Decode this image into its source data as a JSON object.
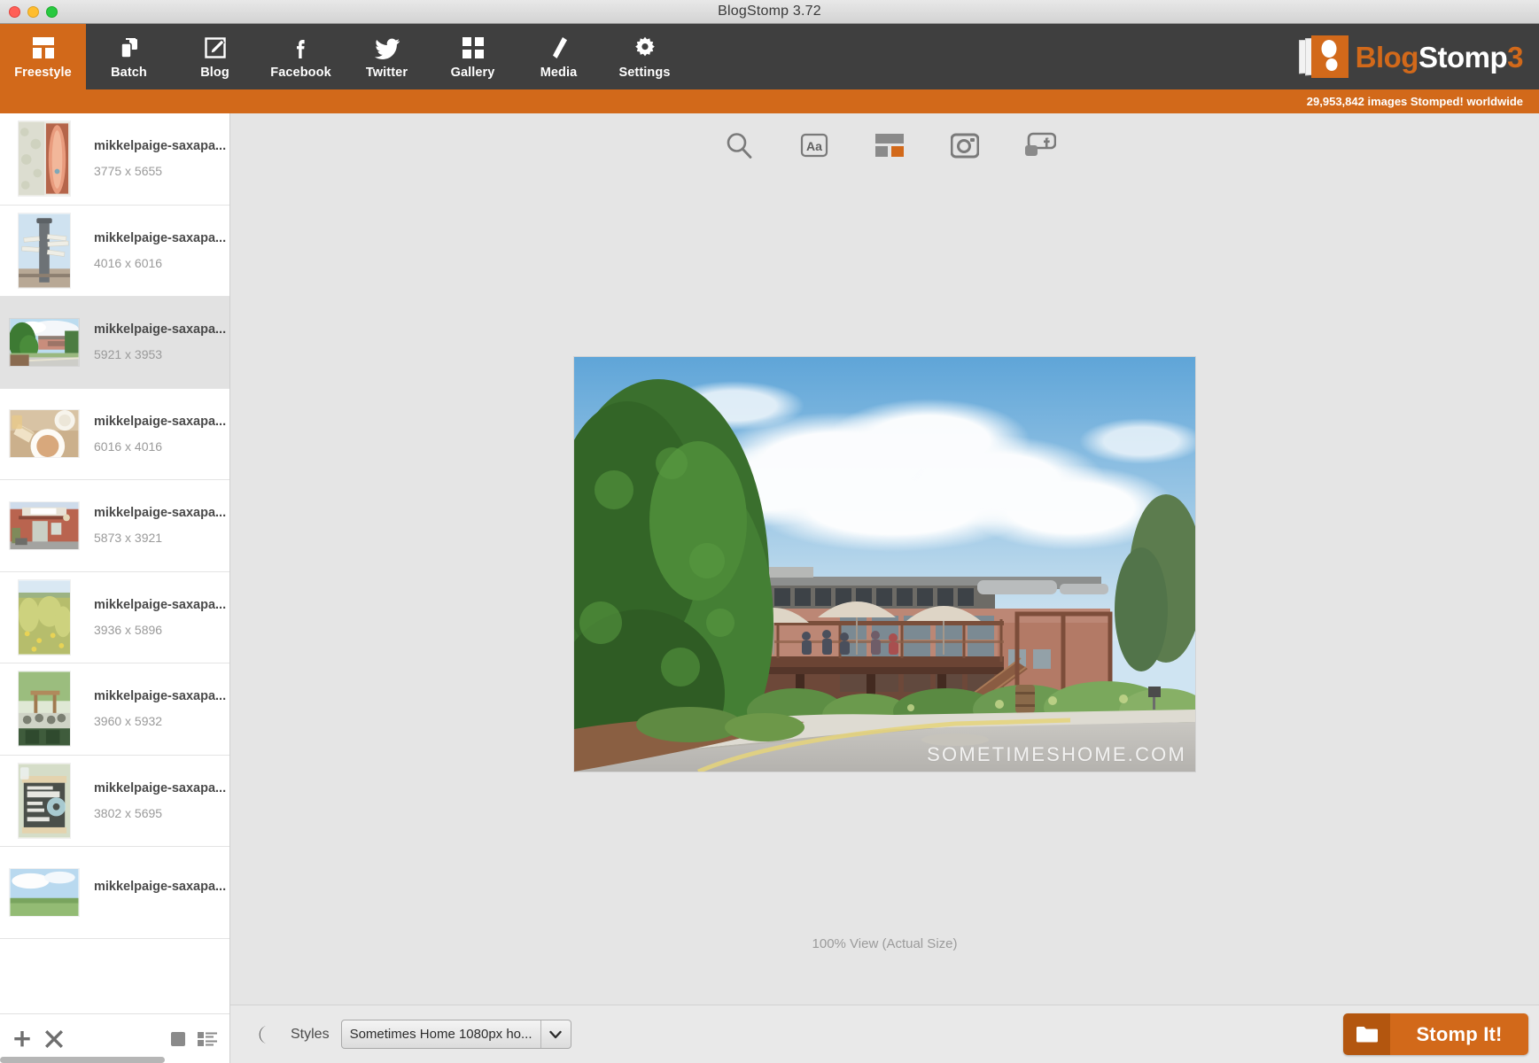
{
  "window": {
    "title": "BlogStomp 3.72",
    "traffic_lights": [
      "close",
      "minimize",
      "maximize"
    ]
  },
  "nav": {
    "items": [
      {
        "label": "Freestyle",
        "icon": "freestyle-layout-icon",
        "active": true
      },
      {
        "label": "Batch",
        "icon": "batch-copy-icon",
        "active": false
      },
      {
        "label": "Blog",
        "icon": "blog-pencil-square-icon",
        "active": false
      },
      {
        "label": "Facebook",
        "icon": "facebook-f-icon",
        "active": false
      },
      {
        "label": "Twitter",
        "icon": "twitter-bird-icon",
        "active": false
      },
      {
        "label": "Gallery",
        "icon": "gallery-grid-icon",
        "active": false
      },
      {
        "label": "Media",
        "icon": "media-pen-icon",
        "active": false
      },
      {
        "label": "Settings",
        "icon": "settings-gear-icon",
        "active": false
      }
    ],
    "brand": {
      "part1": "Blog",
      "part2": "Stomp",
      "part3": "3",
      "icon": "footprint-logo-icon"
    }
  },
  "counter": {
    "text": "29,953,842 images Stomped! worldwide"
  },
  "sidebar": {
    "items": [
      {
        "name": "mikkelpaige-saxapa...",
        "dimensions": "3775 x 5655",
        "orientation": "portrait",
        "selected": false,
        "thumb": "kayak-on-brick-wall"
      },
      {
        "name": "mikkelpaige-saxapa...",
        "dimensions": "4016 x 6016",
        "orientation": "portrait",
        "selected": false,
        "thumb": "signpost-tower"
      },
      {
        "name": "mikkelpaige-saxapa...",
        "dimensions": "5921 x 3953",
        "orientation": "landscape",
        "selected": true,
        "thumb": "mill-building-street"
      },
      {
        "name": "mikkelpaige-saxapa...",
        "dimensions": "6016 x 4016",
        "orientation": "landscape",
        "selected": false,
        "thumb": "soup-and-bread"
      },
      {
        "name": "mikkelpaige-saxapa...",
        "dimensions": "5873 x 3921",
        "orientation": "landscape",
        "selected": false,
        "thumb": "brick-storefront"
      },
      {
        "name": "mikkelpaige-saxapa...",
        "dimensions": "3936 x 5896",
        "orientation": "portrait",
        "selected": false,
        "thumb": "wildflower-meadow"
      },
      {
        "name": "mikkelpaige-saxapa...",
        "dimensions": "3960 x 5932",
        "orientation": "portrait",
        "selected": false,
        "thumb": "outdoor-patio-crowd"
      },
      {
        "name": "mikkelpaige-saxapa...",
        "dimensions": "3802 x 5695",
        "orientation": "portrait",
        "selected": false,
        "thumb": "cake-doughnut-chalkboard"
      },
      {
        "name": "mikkelpaige-saxapa...",
        "dimensions": "",
        "orientation": "landscape",
        "selected": false,
        "thumb": "sky-landscape"
      }
    ],
    "footer": {
      "add_icon": "plus-icon",
      "remove_icon": "close-x-icon",
      "single_view_icon": "single-view-icon",
      "list-view_icon": "list-view-icon"
    }
  },
  "toolstrip": {
    "buttons": [
      {
        "icon": "search-magnifier-icon",
        "name": "zoom-tool"
      },
      {
        "icon": "text-aa-icon",
        "name": "text-tool"
      },
      {
        "icon": "layout-grid-icon",
        "name": "layout-tool"
      },
      {
        "icon": "instagram-camera-icon",
        "name": "instagram-tool"
      },
      {
        "icon": "facebook-share-icon",
        "name": "facebook-tool"
      }
    ]
  },
  "preview": {
    "watermark": "SOMETIMESHOME.COM",
    "zoom_label": "100% View (Actual Size)"
  },
  "bottombar": {
    "moon_icon": "moon-icon",
    "styles_label": "Styles",
    "styles_value": "Sometimes Home 1080px ho...",
    "styles_options": [
      "Sometimes Home 1080px ho..."
    ],
    "stomp_label": "Stomp It!",
    "stomp_icon": "folder-icon"
  },
  "colors": {
    "accent_orange": "#d2691a",
    "accent_orange_dark": "#b3560f",
    "navbar_dark": "#3f3f3f",
    "canvas_gray": "#e5e5e5"
  }
}
